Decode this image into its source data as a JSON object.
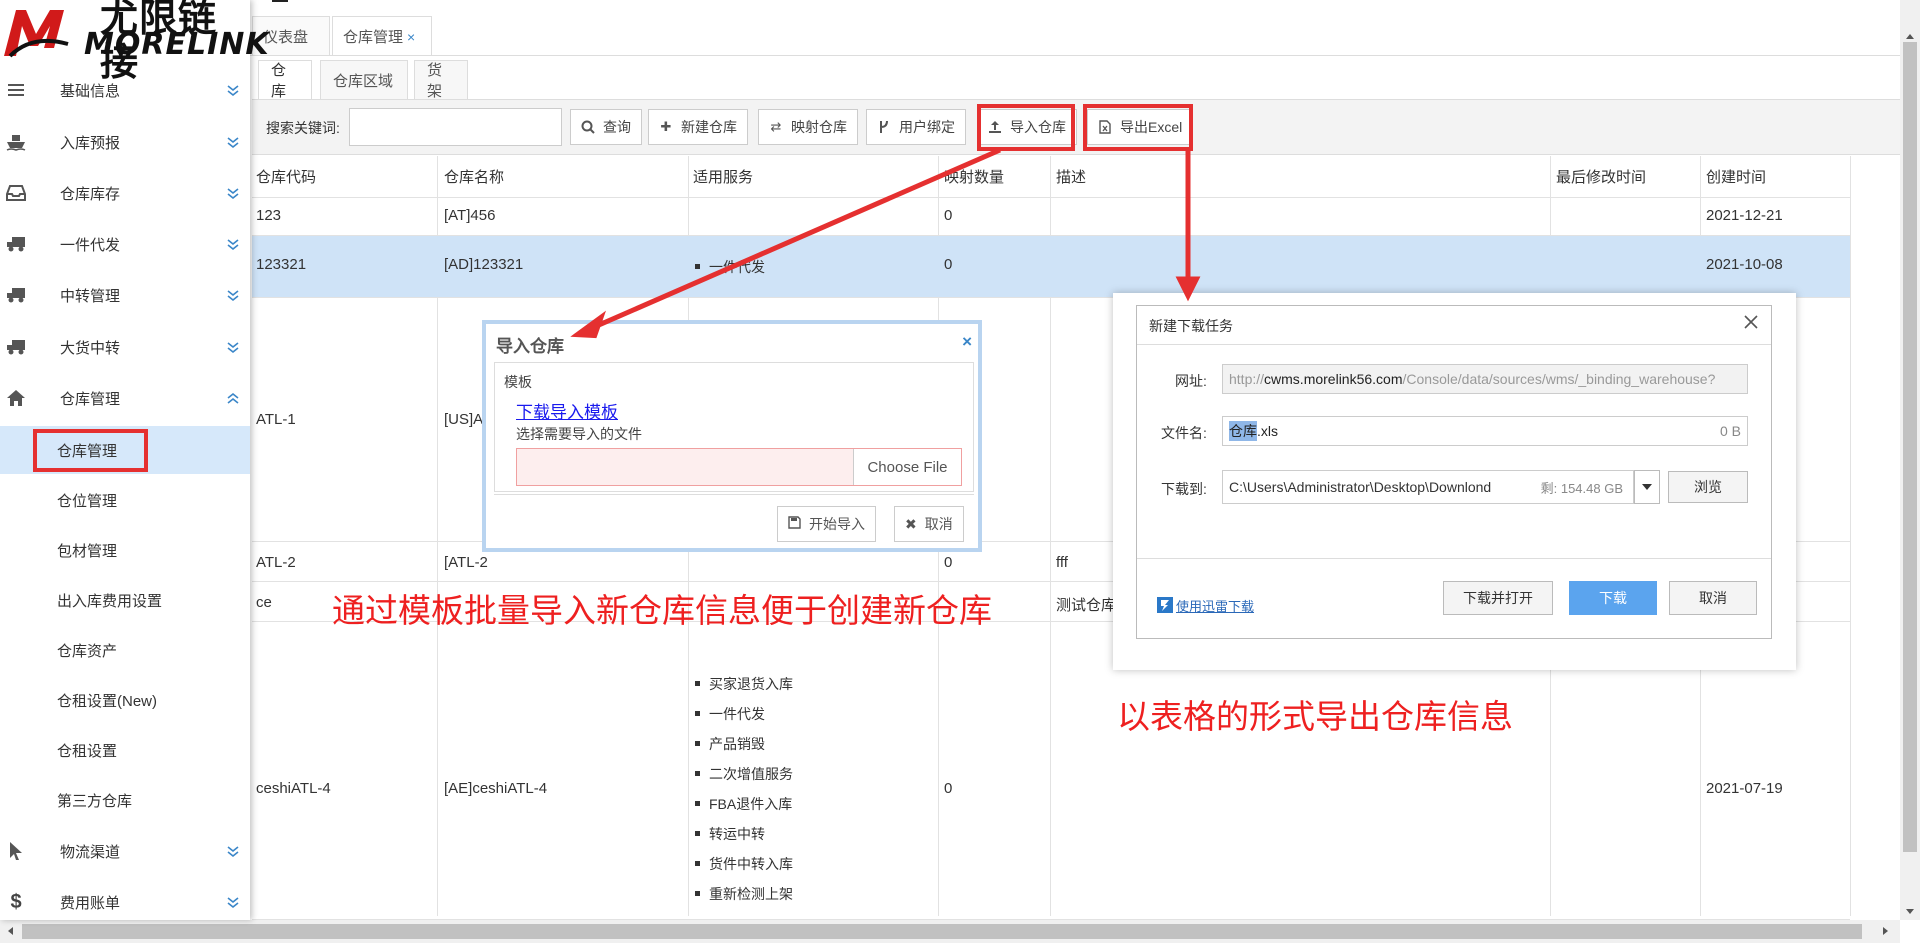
{
  "logo": {
    "cn": "尤限链接",
    "en": "MORELINK"
  },
  "sidebar": {
    "items": [
      {
        "label": "基础信息",
        "icon": "menu-icon"
      },
      {
        "label": "入库预报",
        "icon": "ship-icon"
      },
      {
        "label": "仓库库存",
        "icon": "inbox-icon"
      },
      {
        "label": "一件代发",
        "icon": "truck-icon"
      },
      {
        "label": "中转管理",
        "icon": "truck-icon"
      },
      {
        "label": "大货中转",
        "icon": "truck-icon"
      },
      {
        "label": "仓库管理",
        "icon": "home-icon"
      }
    ],
    "sub_items": [
      {
        "label": "仓库管理"
      },
      {
        "label": "仓位管理"
      },
      {
        "label": "包材管理"
      },
      {
        "label": "出入库费用设置"
      },
      {
        "label": "仓库资产"
      },
      {
        "label": "仓租设置(New)"
      },
      {
        "label": "仓租设置"
      },
      {
        "label": "第三方仓库"
      }
    ],
    "bottom_items": [
      {
        "label": "物流渠道",
        "icon": "cursor-icon"
      },
      {
        "label": "费用账单",
        "icon": "dollar-icon"
      }
    ]
  },
  "page_tabs": [
    {
      "label": "仪表盘"
    },
    {
      "label": "仓库管理",
      "close": "×"
    }
  ],
  "sub_tabs": [
    {
      "label": "仓库"
    },
    {
      "label": "仓库区域"
    },
    {
      "label": "货架"
    }
  ],
  "toolbar": {
    "search_label": "搜索关键词:",
    "buttons": [
      {
        "label": "查询",
        "icon": "search-icon"
      },
      {
        "label": "新建仓库",
        "icon": "plus-icon"
      },
      {
        "label": "映射仓库",
        "icon": "swap-icon"
      },
      {
        "label": "用户绑定",
        "icon": "fork-icon"
      },
      {
        "label": "导入仓库",
        "icon": "upload-icon"
      },
      {
        "label": "导出Excel",
        "icon": "excel-icon"
      }
    ]
  },
  "table": {
    "headers": [
      "仓库代码",
      "仓库名称",
      "适用服务",
      "映射数量",
      "描述",
      "最后修改时间",
      "创建时间"
    ],
    "rows": [
      {
        "code": "123",
        "name": "[AT]456",
        "services": [],
        "mapped": "0",
        "desc": "",
        "modified": "",
        "created": "2021-12-21"
      },
      {
        "code": "123321",
        "name": "[AD]123321",
        "services": [
          "一件代发"
        ],
        "mapped": "0",
        "desc": "",
        "modified": "",
        "created": "2021-10-08"
      },
      {
        "code": "ATL-1",
        "name": "[US]A",
        "services": [],
        "mapped": "",
        "desc": "",
        "modified": "",
        "created": ""
      },
      {
        "code": "ATL-2",
        "name": "[ATL-2",
        "services": [],
        "mapped": "0",
        "desc": "fff",
        "modified": "",
        "created": ""
      },
      {
        "code": "ce",
        "name": "",
        "services": [],
        "mapped": "",
        "desc": "测试仓库",
        "modified": "",
        "created": ""
      },
      {
        "code": "ceshiATL-4",
        "name": "[AE]ceshiATL-4",
        "services": [
          "买家退货入库",
          "一件代发",
          "产品销毁",
          "二次增值服务",
          "FBA退件入库",
          "转运中转",
          "货件中转入库",
          "重新检测上架"
        ],
        "mapped": "0",
        "desc": "",
        "modified": "",
        "created": "2021-07-19"
      }
    ]
  },
  "import_dialog": {
    "title": "导入仓库",
    "close": "×",
    "section": "模板",
    "download_link": "下载导入模板",
    "hint": "选择需要导入的文件",
    "choose_file": "Choose File",
    "start_import": "开始导入",
    "cancel": "取消"
  },
  "download_dialog": {
    "title": "新建下载任务",
    "url_label": "网址:",
    "url_prefix": "http://",
    "url_host": "cwms.morelink56.com",
    "url_path": "/Console/data/sources/wms/_binding_warehouse?",
    "filename_label": "文件名:",
    "filename_selected": "仓库",
    "filename_ext": ".xls",
    "size": "0 B",
    "saveto_label": "下载到:",
    "saveto_path": "C:\\Users\\Administrator\\Desktop\\Downlond",
    "free_space": "剩: 154.48 GB",
    "browse": "浏览",
    "thunder_link": "使用迅雷下载",
    "download_open": "下载并打开",
    "download": "下载",
    "cancel": "取消"
  },
  "annotations": {
    "import_note": "通过模板批量导入新仓库信息便于创建新仓库",
    "export_note": "以表格的形式导出仓库信息"
  },
  "colors": {
    "accent": "#3a86c8",
    "selected_row": "#cfe3f7",
    "annotation": "#e53030",
    "primary_button": "#5ba4ee"
  }
}
